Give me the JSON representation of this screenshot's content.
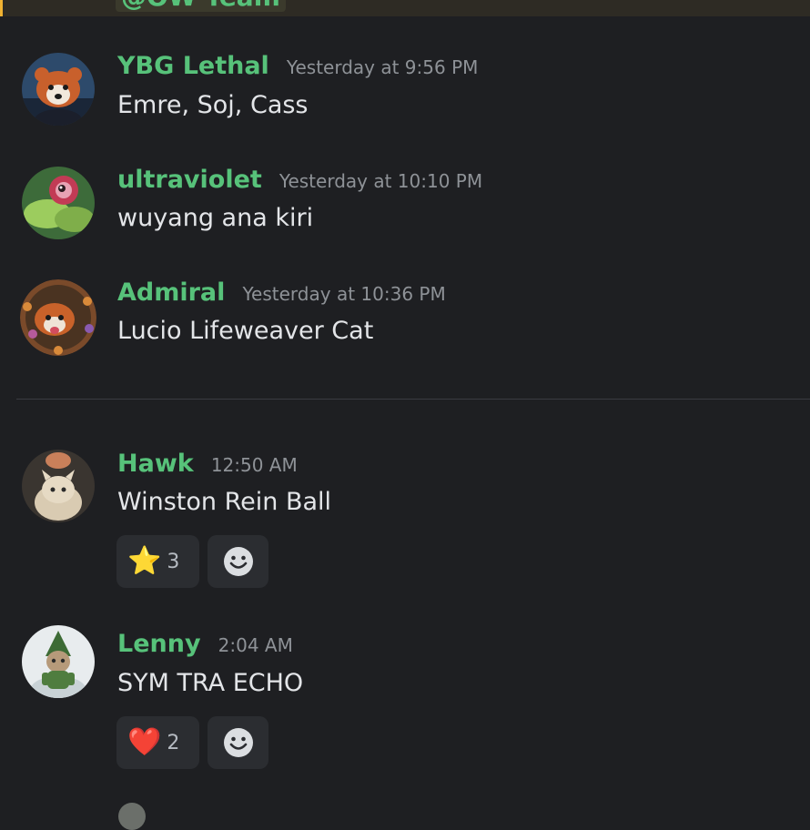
{
  "top_banner": {
    "mention": "@OW Team"
  },
  "messages": [
    {
      "username": "YBG Lethal",
      "timestamp": "Yesterday at 9:56 PM",
      "content": "Emre, Soj, Cass",
      "avatar": "red-panda"
    },
    {
      "username": "ultraviolet",
      "timestamp": "Yesterday at 10:10 PM",
      "content": "wuyang ana kiri",
      "avatar": "pokemon-bellsprout"
    },
    {
      "username": "Admiral",
      "timestamp": "Yesterday at 10:36 PM",
      "content": "Lucio Lifeweaver Cat",
      "avatar": "red-panda-wreath"
    },
    {
      "username": "Hawk",
      "timestamp": "12:50 AM",
      "content": "Winston Rein Ball",
      "avatar": "cats",
      "reactions": [
        {
          "emoji": "⭐",
          "count": "3"
        }
      ]
    },
    {
      "username": "Lenny",
      "timestamp": "2:04 AM",
      "content": "SYM TRA ECHO",
      "avatar": "elf-cat",
      "reactions": [
        {
          "emoji": "❤️",
          "count": "2"
        }
      ]
    }
  ],
  "colors": {
    "background": "#1e1f22",
    "username": "#57c27a",
    "timestamp": "#8e9297",
    "reaction_bg": "#2b2d31",
    "banner_accent": "#f0b232"
  },
  "icons": {
    "add_reaction": "smiley-face-icon"
  }
}
